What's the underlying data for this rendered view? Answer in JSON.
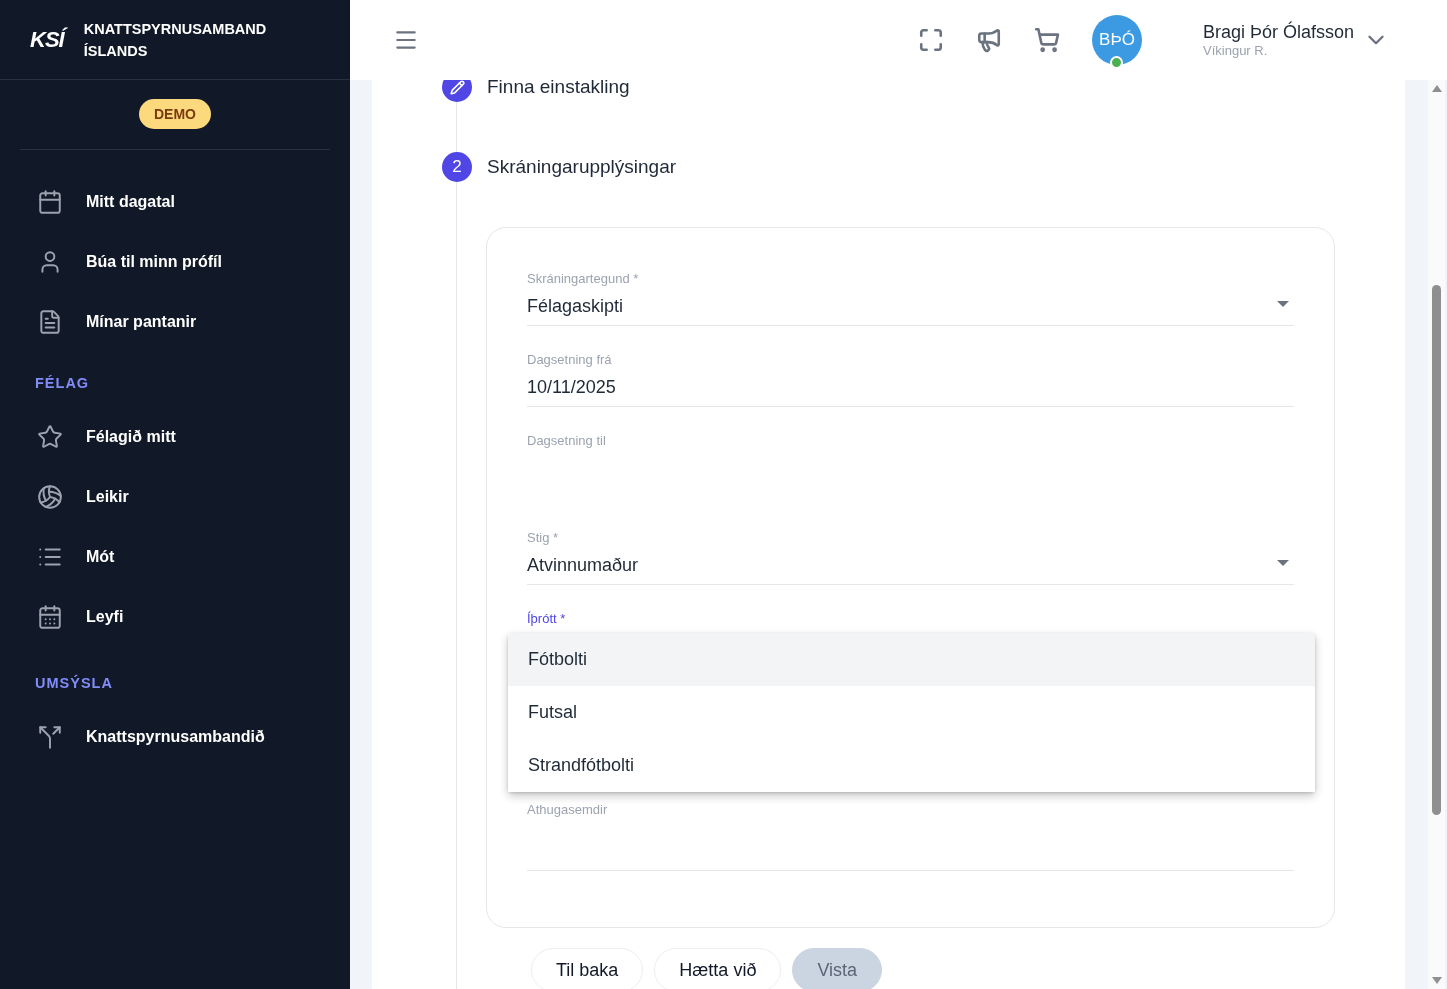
{
  "sidebar": {
    "org_name": "KNATTSPYRNUSAMBAND ÍSLANDS",
    "logo": "KSÍ",
    "badge": "DEMO",
    "sections": [
      {
        "items": [
          {
            "label": "Mitt dagatal"
          },
          {
            "label": "Búa til minn prófíl"
          },
          {
            "label": "Mínar pantanir"
          }
        ]
      },
      {
        "title": "FÉLAG",
        "items": [
          {
            "label": "Félagið mitt"
          },
          {
            "label": "Leikir"
          },
          {
            "label": "Mót"
          },
          {
            "label": "Leyfi"
          }
        ]
      },
      {
        "title": "UMSÝSLA",
        "items": [
          {
            "label": "Knattspyrnusambandið"
          }
        ]
      }
    ]
  },
  "header": {
    "avatar_initials": "BÞÓ",
    "online": true,
    "user_name": "Bragi Þór Ólafsson",
    "user_club": "Víkingur R."
  },
  "steps": [
    {
      "kind": "done",
      "label": "Finna einstakling"
    },
    {
      "kind": "number",
      "number": "2",
      "label": "Skráningarupplýsingar"
    }
  ],
  "form": {
    "fields": [
      {
        "kind": "select",
        "label": "Skráningartegund *",
        "value": "Félagaskipti",
        "focused": false
      },
      {
        "kind": "date",
        "label": "Dagsetning frá",
        "value": "10/11/2025",
        "focused": false
      },
      {
        "kind": "date",
        "label": "Dagsetning til",
        "focused": false
      },
      {
        "kind": "select",
        "label": "Stig *",
        "value": "Atvinnumaður",
        "focused": false
      },
      {
        "kind": "select",
        "label": "Íþrótt *",
        "focused": true
      },
      {
        "kind": "textarea",
        "label": "Athugasemdir",
        "focused": false
      }
    ],
    "menu": [
      {
        "label": "Fótbolti",
        "selected": true
      },
      {
        "label": "Futsal",
        "selected": false
      },
      {
        "label": "Strandfótbolti",
        "selected": false
      }
    ]
  },
  "buttons": [
    {
      "label": "Til baka",
      "disabled": false
    },
    {
      "label": "Hætta við",
      "disabled": false
    },
    {
      "label": "Vista",
      "disabled": true
    }
  ]
}
